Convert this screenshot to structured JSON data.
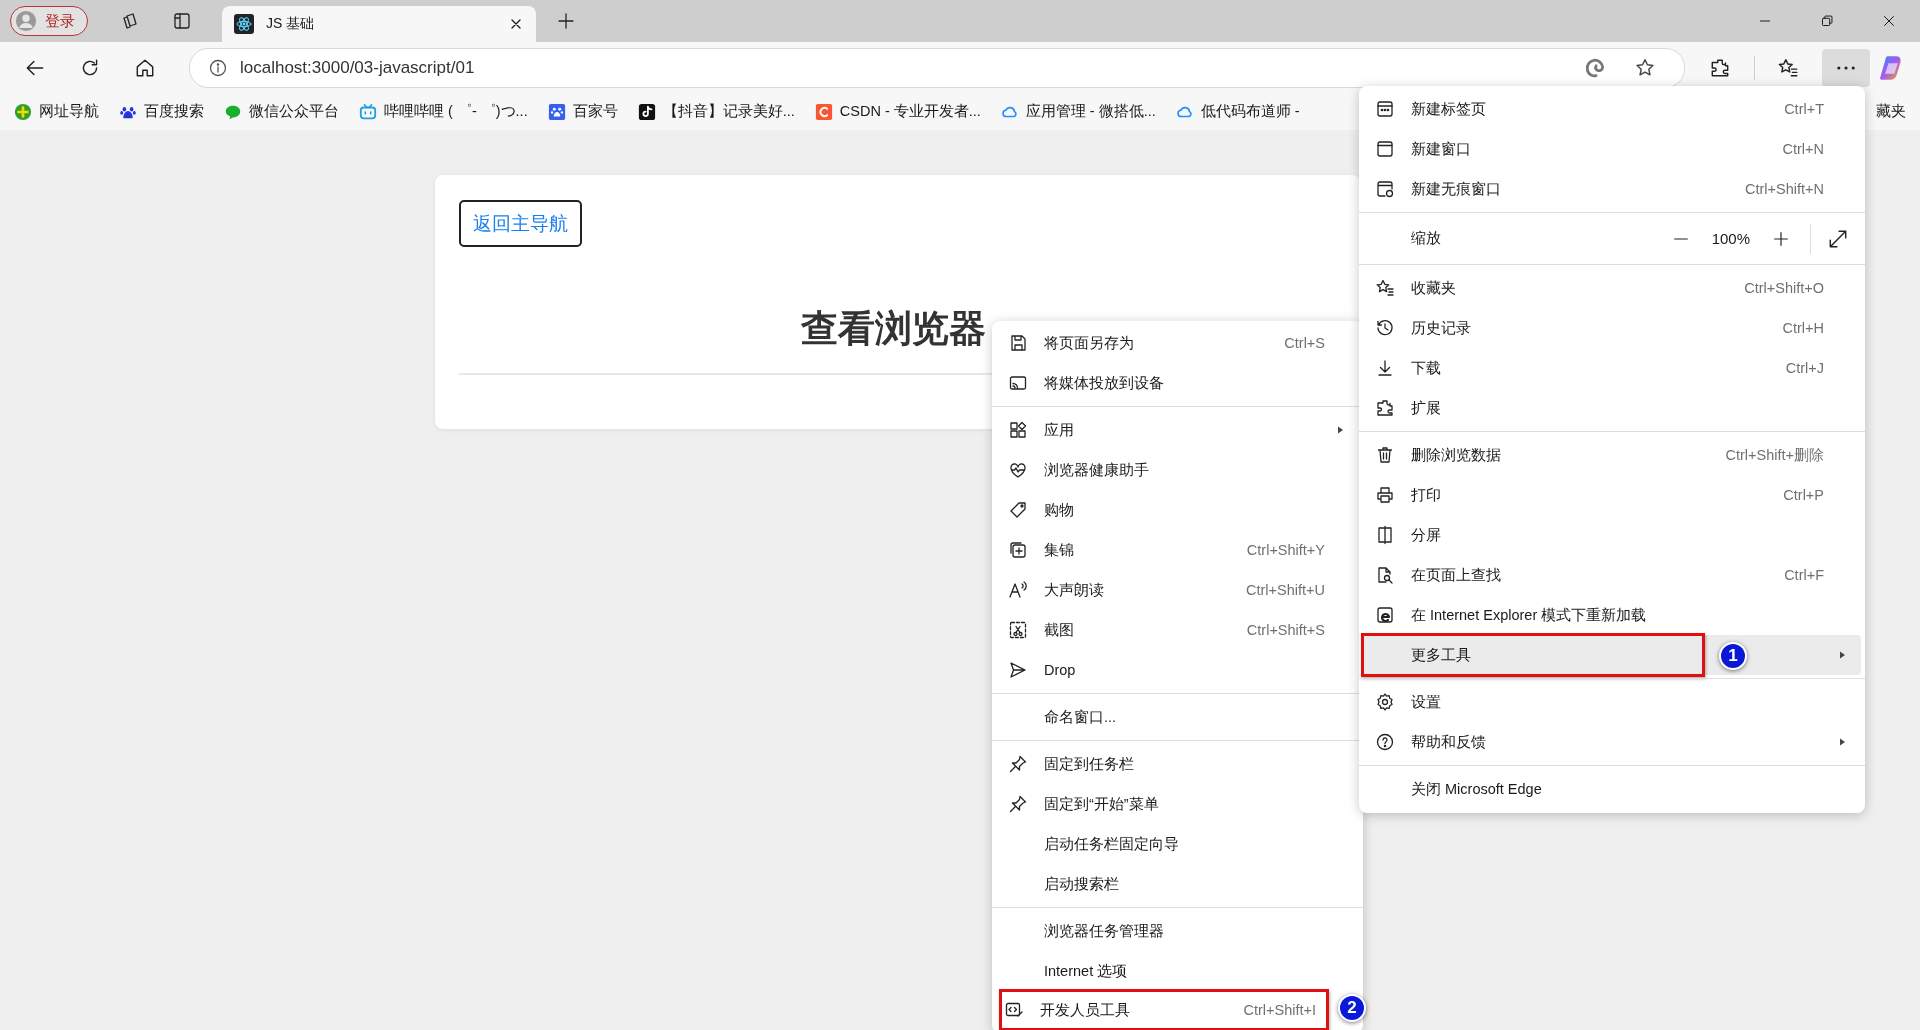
{
  "title_bar": {
    "profile_button": "登录",
    "tabs": [
      {
        "title": "JS 基础",
        "selected": true
      }
    ]
  },
  "toolbar": {
    "url": "localhost:3000/03-javascript/01",
    "menu_open": true
  },
  "bookmarks": [
    {
      "label": "网址导航"
    },
    {
      "label": "百度搜索"
    },
    {
      "label": "微信公众平台"
    },
    {
      "label": "哔哩哔哩 ( ゜- ゜)つ..."
    },
    {
      "label": "百家号"
    },
    {
      "label": "【抖音】记录美好..."
    },
    {
      "label": "CSDN - 专业开发者..."
    },
    {
      "label": "应用管理 - 微搭低..."
    },
    {
      "label": "低代码布道师 -"
    }
  ],
  "bookmarks_overflow": "藏夹",
  "page": {
    "back_button": "返回主导航",
    "heading": "查看浏览器"
  },
  "more_tools_menu": [
    {
      "kind": "item",
      "label": "将页面另存为",
      "shortcut": "Ctrl+S"
    },
    {
      "kind": "item",
      "label": "将媒体投放到设备"
    },
    {
      "kind": "separator"
    },
    {
      "kind": "item",
      "label": "应用",
      "has_submenu": true
    },
    {
      "kind": "item",
      "label": "浏览器健康助手"
    },
    {
      "kind": "item",
      "label": "购物"
    },
    {
      "kind": "item",
      "label": "集锦",
      "shortcut": "Ctrl+Shift+Y"
    },
    {
      "kind": "item",
      "label": "大声朗读",
      "shortcut": "Ctrl+Shift+U"
    },
    {
      "kind": "item",
      "label": "截图",
      "shortcut": "Ctrl+Shift+S"
    },
    {
      "kind": "item",
      "label": "Drop"
    },
    {
      "kind": "separator"
    },
    {
      "kind": "item",
      "label": "命名窗口..."
    },
    {
      "kind": "separator"
    },
    {
      "kind": "item",
      "label": "固定到任务栏"
    },
    {
      "kind": "item",
      "label": "固定到“开始”菜单"
    },
    {
      "kind": "item",
      "label": "启动任务栏固定向导"
    },
    {
      "kind": "item",
      "label": "启动搜索栏"
    },
    {
      "kind": "separator"
    },
    {
      "kind": "item",
      "label": "浏览器任务管理器"
    },
    {
      "kind": "item",
      "label": "Internet 选项"
    },
    {
      "kind": "item",
      "label": "开发人员工具",
      "shortcut": "Ctrl+Shift+I",
      "callout": "2"
    }
  ],
  "app_menu": [
    {
      "kind": "item",
      "label": "新建标签页",
      "shortcut": "Ctrl+T"
    },
    {
      "kind": "item",
      "label": "新建窗口",
      "shortcut": "Ctrl+N"
    },
    {
      "kind": "item",
      "label": "新建无痕窗口",
      "shortcut": "Ctrl+Shift+N"
    },
    {
      "kind": "separator"
    },
    {
      "kind": "zoom",
      "label": "缩放",
      "value": "100%"
    },
    {
      "kind": "separator"
    },
    {
      "kind": "item",
      "label": "收藏夹",
      "shortcut": "Ctrl+Shift+O"
    },
    {
      "kind": "item",
      "label": "历史记录",
      "shortcut": "Ctrl+H"
    },
    {
      "kind": "item",
      "label": "下载",
      "shortcut": "Ctrl+J"
    },
    {
      "kind": "item",
      "label": "扩展"
    },
    {
      "kind": "separator"
    },
    {
      "kind": "item",
      "label": "删除浏览数据",
      "shortcut": "Ctrl+Shift+删除"
    },
    {
      "kind": "item",
      "label": "打印",
      "shortcut": "Ctrl+P"
    },
    {
      "kind": "item",
      "label": "分屏"
    },
    {
      "kind": "item",
      "label": "在页面上查找",
      "shortcut": "Ctrl+F"
    },
    {
      "kind": "item",
      "label": "在 Internet Explorer 模式下重新加载"
    },
    {
      "kind": "item",
      "label": "更多工具",
      "has_submenu": true,
      "selected": true,
      "callout": "1"
    },
    {
      "kind": "separator"
    },
    {
      "kind": "item",
      "label": "设置"
    },
    {
      "kind": "item",
      "label": "帮助和反馈",
      "has_submenu": true
    },
    {
      "kind": "separator"
    },
    {
      "kind": "item",
      "label": "关闭 Microsoft Edge"
    }
  ]
}
